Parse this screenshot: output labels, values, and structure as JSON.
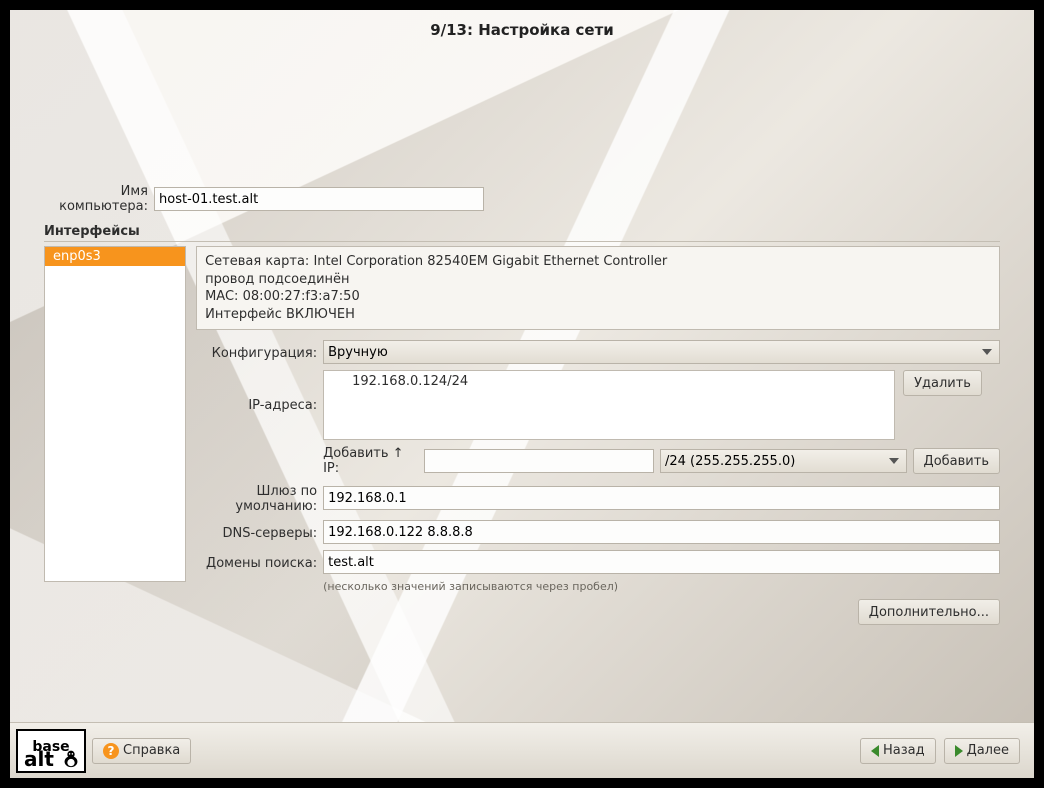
{
  "header": {
    "title": "9/13: Настройка сети"
  },
  "hostname": {
    "label": "Имя компьютера:",
    "value": "host-01.test.alt"
  },
  "interfaces": {
    "heading": "Интерфейсы",
    "items": [
      {
        "name": "enp0s3"
      }
    ]
  },
  "info": {
    "line1": "Сетевая карта: Intel Corporation 82540EM Gigabit Ethernet Controller",
    "line2": "провод подсоединён",
    "line3": "MAC: 08:00:27:f3:a7:50",
    "line4": "Интерфейс ВКЛЮЧЕН"
  },
  "form": {
    "config_label": "Конфигурация:",
    "config_value": "Вручную",
    "ip_label": "IP-адреса:",
    "ip_items": [
      "192.168.0.124/24"
    ],
    "delete_label": "Удалить",
    "add_ip_label": "Добавить ↑ IP:",
    "add_ip_value": "",
    "mask_value": "/24 (255.255.255.0)",
    "add_btn_label": "Добавить",
    "gateway_label": "Шлюз по умолчанию:",
    "gateway_value": "192.168.0.1",
    "dns_label": "DNS-серверы:",
    "dns_value": "192.168.0.122 8.8.8.8",
    "domains_label": "Домены поиска:",
    "domains_value": "test.alt",
    "hint": "(несколько значений записываются через пробел)",
    "advanced_label": "Дополнительно..."
  },
  "footer": {
    "logo_line1": "base",
    "logo_line2": "alt",
    "help_label": "Справка",
    "back_label": "Назад",
    "next_label": "Далее"
  }
}
